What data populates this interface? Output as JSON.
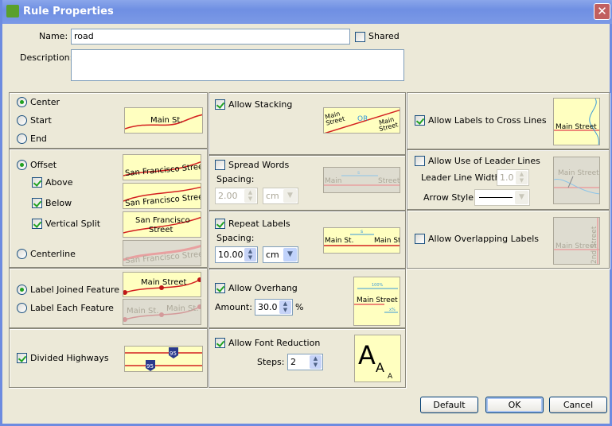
{
  "window": {
    "title": "Rule Properties",
    "close": "✕"
  },
  "name": {
    "label": "Name:",
    "value": "road"
  },
  "shared": {
    "label": "Shared",
    "checked": false
  },
  "description": {
    "label": "Description:",
    "value": ""
  },
  "position": {
    "center": "Center",
    "start": "Start",
    "end": "End",
    "selected": "Center",
    "preview": "Main St."
  },
  "offset": {
    "offset": "Offset",
    "above": "Above",
    "below": "Below",
    "vertical_split": "Vertical Split",
    "centerline": "Centerline",
    "selected": "Offset",
    "preview1": "San Francisco Street",
    "preview_split1": "San Francisco",
    "preview_split2": "Street"
  },
  "joined": {
    "joined": "Label Joined Feature",
    "each": "Label Each Feature",
    "selected": "Label Joined Feature",
    "preview_joined": "Main Street",
    "preview_each": "Main St."
  },
  "divided": {
    "label": "Divided Highways",
    "checked": true,
    "shield": "95"
  },
  "stacking": {
    "label": "Allow Stacking",
    "checked": true,
    "preview_a": "Main",
    "preview_b": "Street",
    "preview_or": "OR"
  },
  "spread": {
    "label": "Spread Words",
    "checked": false,
    "spacing_label": "Spacing:",
    "spacing": "2.00",
    "unit": "cm",
    "preview_a": "Main",
    "preview_b": "Street",
    "preview_s": "s"
  },
  "repeat": {
    "label": "Repeat Labels",
    "checked": true,
    "spacing_label": "Spacing:",
    "spacing": "10.00",
    "unit": "cm",
    "preview": "Main St.",
    "preview_s": "s"
  },
  "overhang": {
    "label": "Allow Overhang",
    "checked": true,
    "amount_label": "Amount:",
    "amount": "30.0",
    "unit": "%",
    "preview": "Main Street",
    "preview_top": "100%",
    "preview_bottom": "x%"
  },
  "font_reduction": {
    "label": "Allow Font Reduction",
    "checked": true,
    "steps_label": "Steps:",
    "steps": "2",
    "preview": "A"
  },
  "cross": {
    "label": "Allow Labels to Cross Lines",
    "checked": true,
    "preview": "Main Street"
  },
  "leader": {
    "label": "Allow Use of Leader Lines",
    "checked": false,
    "width_label": "Leader Line Width:",
    "width": "1.0",
    "arrow_label": "Arrow Style:",
    "preview": "Main Street"
  },
  "overlap": {
    "label": "Allow Overlapping Labels",
    "checked": false,
    "preview": "Main Street",
    "preview_v": "2nd Street"
  },
  "buttons": {
    "default": "Default",
    "ok": "OK",
    "cancel": "Cancel"
  },
  "colors": {
    "preview_bg": "#ffffc0",
    "road": "#d42020",
    "check": "#21a121",
    "titlebar": "#7b99e6"
  }
}
